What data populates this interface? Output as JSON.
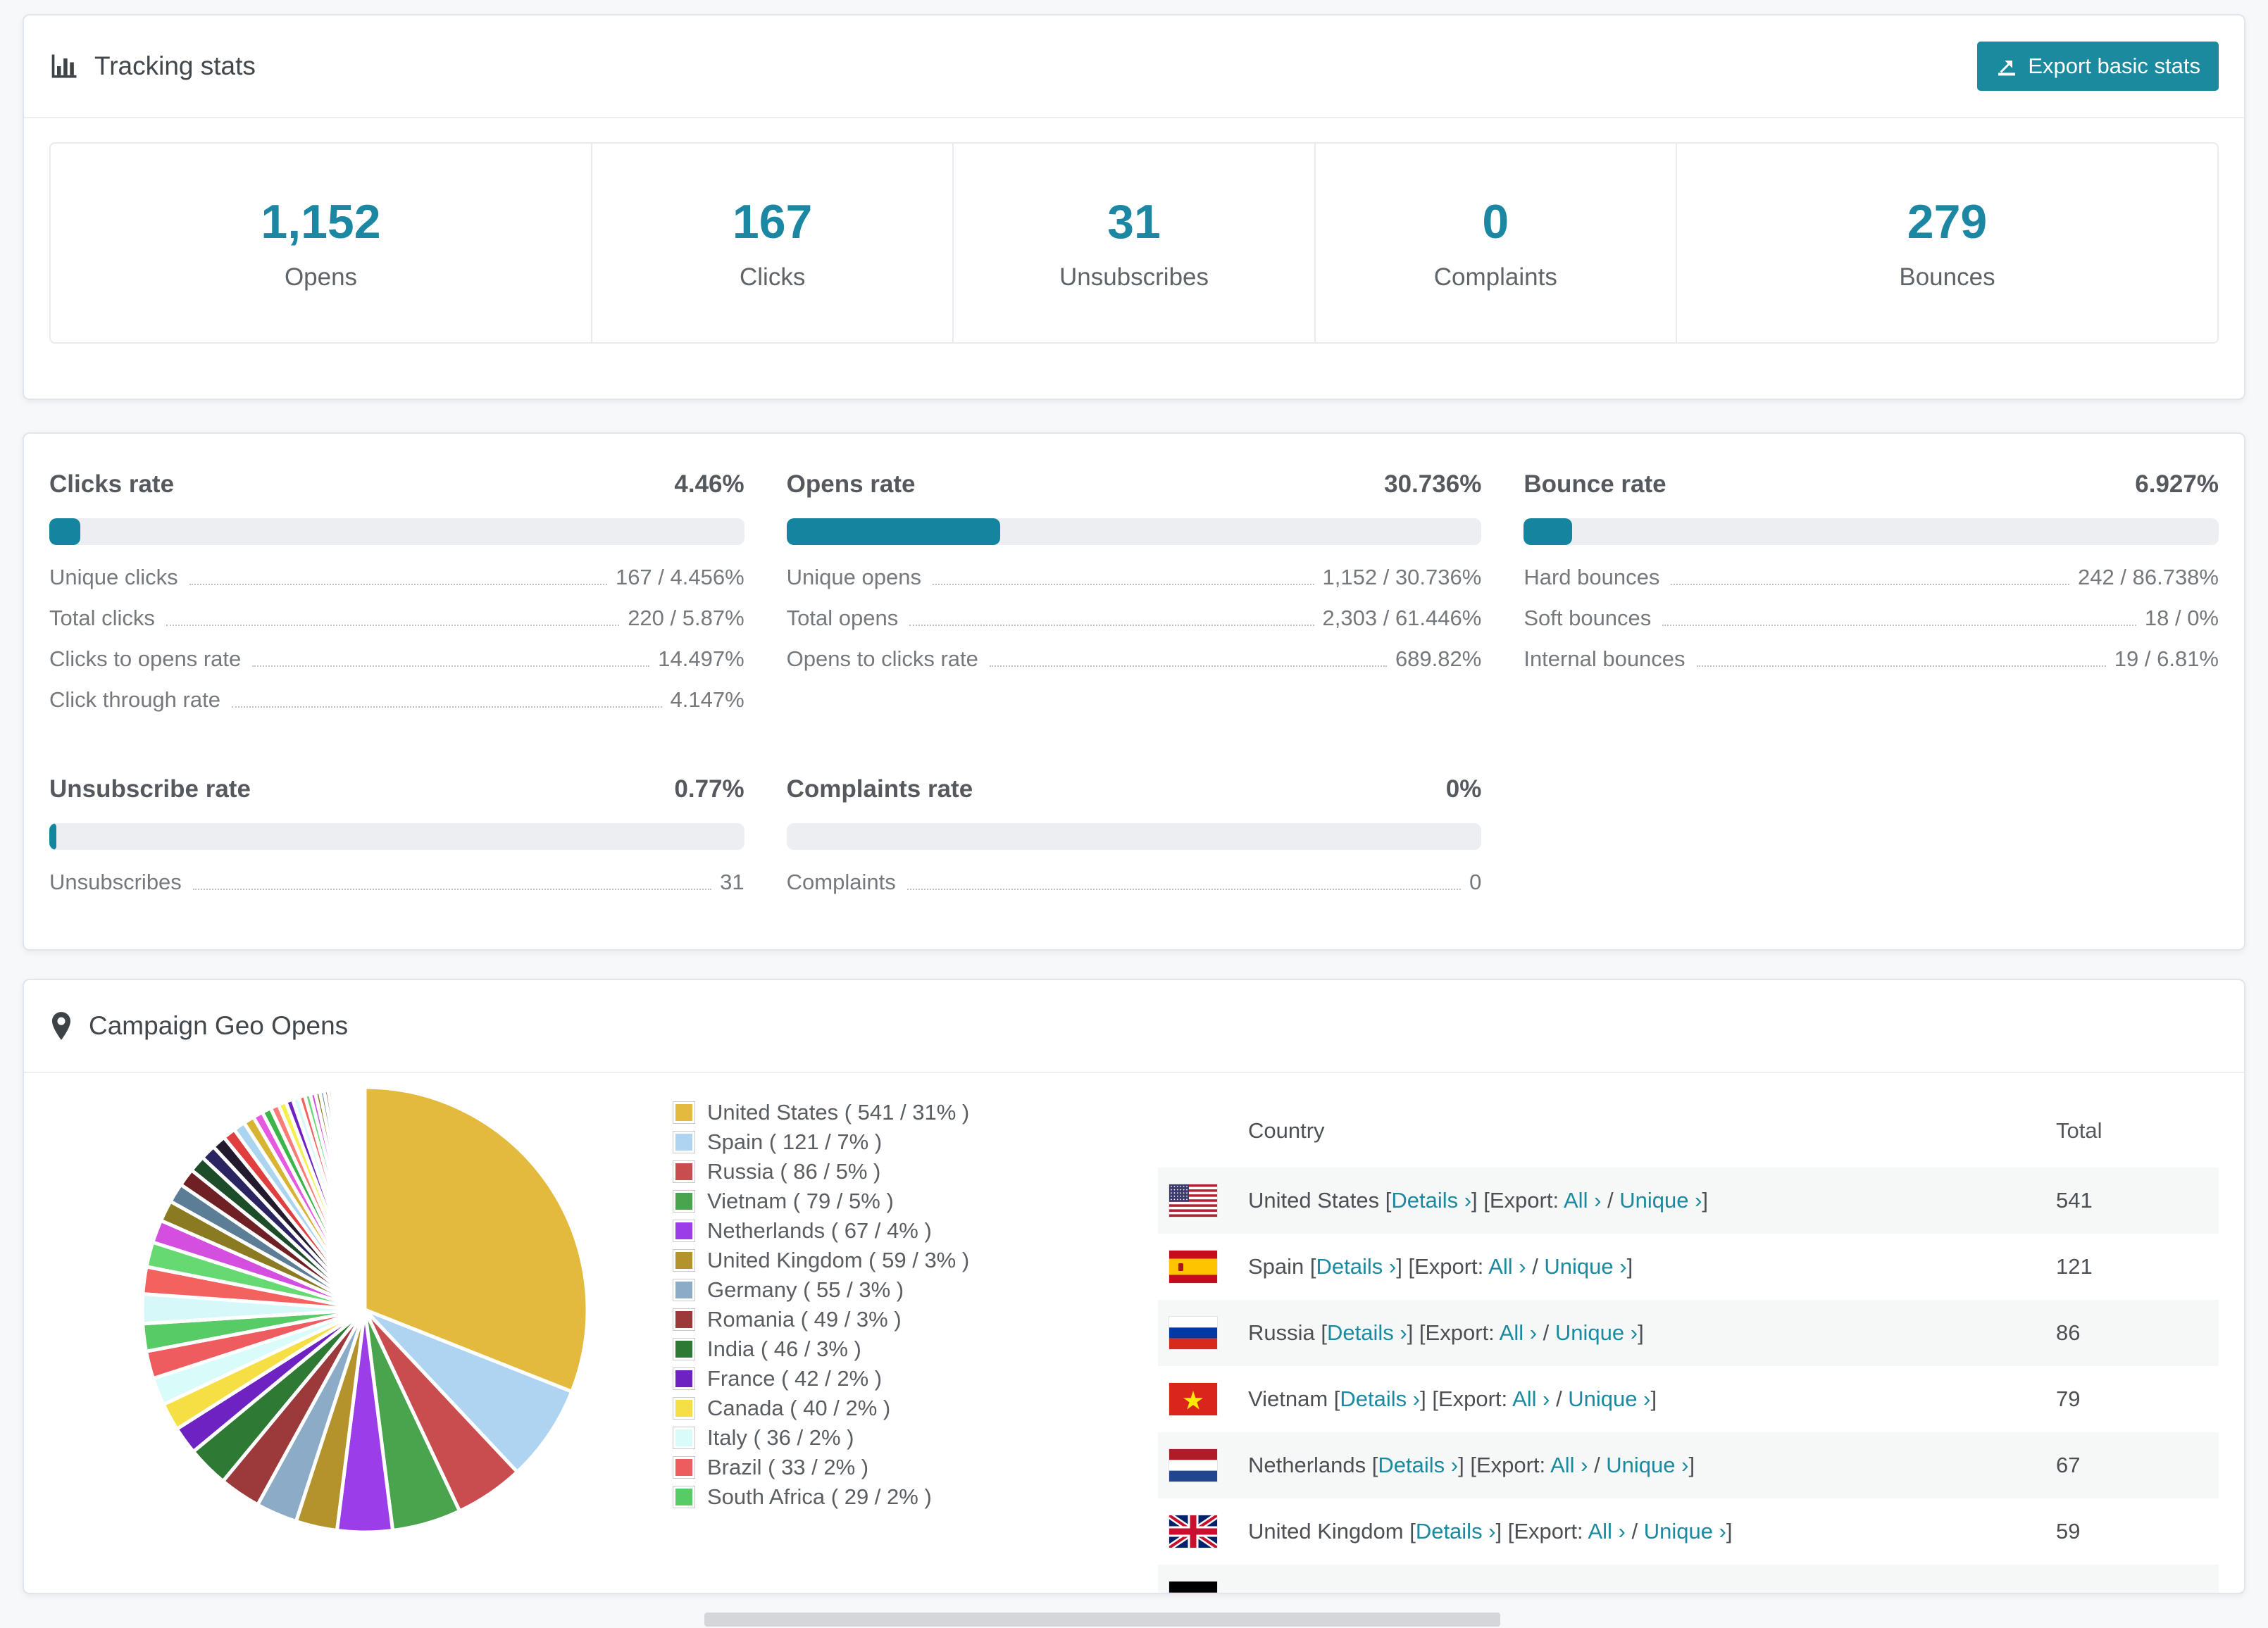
{
  "tracking": {
    "title": "Tracking stats",
    "export_button": {
      "label": "Export basic stats"
    },
    "summary": [
      {
        "value": "1,152",
        "label": "Opens"
      },
      {
        "value": "167",
        "label": "Clicks"
      },
      {
        "value": "31",
        "label": "Unsubscribes"
      },
      {
        "value": "0",
        "label": "Complaints"
      },
      {
        "value": "279",
        "label": "Bounces"
      }
    ]
  },
  "rates": {
    "accent_color": "#15849e",
    "blocks": [
      {
        "title": "Clicks rate",
        "percent": "4.46%",
        "bar_pct": 4.46,
        "rows": [
          [
            "Unique clicks",
            "167 / 4.456%"
          ],
          [
            "Total clicks",
            "220 / 5.87%"
          ],
          [
            "Clicks to opens rate",
            "14.497%"
          ],
          [
            "Click through rate",
            "4.147%"
          ]
        ]
      },
      {
        "title": "Opens rate",
        "percent": "30.736%",
        "bar_pct": 30.736,
        "rows": [
          [
            "Unique opens",
            "1,152 / 30.736%"
          ],
          [
            "Total opens",
            "2,303 / 61.446%"
          ],
          [
            "Opens to clicks rate",
            "689.82%"
          ]
        ]
      },
      {
        "title": "Bounce rate",
        "percent": "6.927%",
        "bar_pct": 6.927,
        "rows": [
          [
            "Hard bounces",
            "242 / 86.738%"
          ],
          [
            "Soft bounces",
            "18 / 0%"
          ],
          [
            "Internal bounces",
            "19 / 6.81%"
          ]
        ]
      },
      {
        "title": "Unsubscribe rate",
        "percent": "0.77%",
        "bar_pct": 0.77,
        "rows": [
          [
            "Unsubscribes",
            "31"
          ]
        ]
      },
      {
        "title": "Complaints rate",
        "percent": "0%",
        "bar_pct": 0,
        "rows": [
          [
            "Complaints",
            "0"
          ]
        ]
      }
    ]
  },
  "geo": {
    "title": "Campaign Geo Opens",
    "legend": [
      {
        "label": "United States ( 541 / 31% )",
        "color": "#e3ba3e"
      },
      {
        "label": "Spain ( 121 / 7% )",
        "color": "#aed4f2"
      },
      {
        "label": "Russia ( 86 / 5% )",
        "color": "#c94d4f"
      },
      {
        "label": "Vietnam ( 79 / 5% )",
        "color": "#4aa44e"
      },
      {
        "label": "Netherlands ( 67 / 4% )",
        "color": "#9b3de8"
      },
      {
        "label": "United Kingdom ( 59 / 3% )",
        "color": "#b4932c"
      },
      {
        "label": "Germany ( 55 / 3% )",
        "color": "#8cabc6"
      },
      {
        "label": "Romania ( 49 / 3% )",
        "color": "#9c393b"
      },
      {
        "label": "India ( 46 / 3% )",
        "color": "#2e7a34"
      },
      {
        "label": "France ( 42 / 2% )",
        "color": "#6f22c2"
      },
      {
        "label": "Canada ( 40 / 2% )",
        "color": "#f6df45"
      },
      {
        "label": "Italy ( 36 / 2% )",
        "color": "#d9fbfa"
      },
      {
        "label": "Brazil ( 33 / 2% )",
        "color": "#ee5c5f"
      },
      {
        "label": "South Africa ( 29 / 2% )",
        "color": "#57cb66"
      }
    ],
    "table": {
      "headers": [
        "Country",
        "Total"
      ],
      "link_labels": {
        "open": "[",
        "details": "Details ›",
        "mid": "] [Export: ",
        "all": "All ›",
        "slash": " / ",
        "unique": "Unique ›",
        "close": "]"
      },
      "rows": [
        {
          "country": "United States",
          "flag": "us",
          "total": "541"
        },
        {
          "country": "Spain",
          "flag": "es",
          "total": "121"
        },
        {
          "country": "Russia",
          "flag": "ru",
          "total": "86"
        },
        {
          "country": "Vietnam",
          "flag": "vn",
          "total": "79"
        },
        {
          "country": "Netherlands",
          "flag": "nl",
          "total": "67"
        },
        {
          "country": "United Kingdom",
          "flag": "gb",
          "total": "59"
        }
      ],
      "partial_row": {
        "flag": "de"
      }
    }
  },
  "chart_data": {
    "type": "pie",
    "title": "Campaign Geo Opens",
    "categories": [
      "United States",
      "Spain",
      "Russia",
      "Vietnam",
      "Netherlands",
      "United Kingdom",
      "Germany",
      "Romania",
      "India",
      "France",
      "Canada",
      "Italy",
      "Brazil",
      "South Africa"
    ],
    "values": [
      541,
      121,
      86,
      79,
      67,
      59,
      55,
      49,
      46,
      42,
      40,
      36,
      33,
      29
    ],
    "percents": [
      31,
      7,
      5,
      5,
      4,
      3,
      3,
      3,
      3,
      2,
      2,
      2,
      2,
      2
    ],
    "colors": [
      "#e3ba3e",
      "#aed4f2",
      "#c94d4f",
      "#4aa44e",
      "#9b3de8",
      "#b4932c",
      "#8cabc6",
      "#9c393b",
      "#2e7a34",
      "#6f22c2",
      "#f6df45",
      "#d9fbfa",
      "#ee5c5f",
      "#57cb66"
    ],
    "other_percent": 26,
    "other_slices_count": 44,
    "filler_palette": [
      "#d7f8f8",
      "#f4625f",
      "#66d973",
      "#d44fe0",
      "#8a7a22",
      "#5b7d96",
      "#6e2024",
      "#1d4d28",
      "#2a2560",
      "#241a2e",
      "#e03f3f",
      "#aad4f0",
      "#d8b433",
      "#e55ae0",
      "#3bb54a",
      "#fb7b76",
      "#f2ef4f",
      "#6f22c2"
    ],
    "legend_position": "right",
    "start_angle_deg": -90,
    "direction": "clockwise"
  }
}
